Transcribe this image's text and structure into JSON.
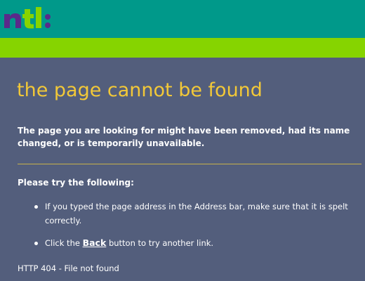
{
  "header": {
    "logo_text": "ntl:",
    "logo_colors": {
      "n": "#5a2a8a",
      "t": "#86d400",
      "l": "#86d400",
      "colon": "#5a2a8a"
    },
    "bg_color": "#00998a",
    "stripe_color": "#86d400"
  },
  "error": {
    "title": "the page cannot be found",
    "intro": "The page you are looking for might have been removed, had its name changed, or is temporarily unavailable.",
    "try_heading": "Please try the following:",
    "suggestion_1": "If you typed the page address in the Address bar, make sure that it is spelt correctly.",
    "suggestion_2_before": "Click the",
    "suggestion_2_link": "Back",
    "suggestion_2_after": "button to try another link.",
    "status": "HTTP 404 - File not found"
  },
  "colors": {
    "page_bg": "#535e7c",
    "title": "#f2c838",
    "text": "#ffffff"
  }
}
